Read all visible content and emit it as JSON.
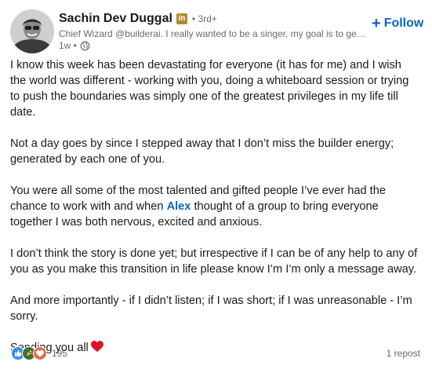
{
  "author": {
    "name": "Sachin Dev Duggal",
    "badge_icon": "linkedin-premium-icon",
    "badge_text": "in",
    "degree": "• 3rd+",
    "headline": "Chief Wizard @builderai. I really wanted to be a singer, my goal is to get the attention of the world and I need your help",
    "timestamp": "1w •",
    "visibility_icon": "globe-icon"
  },
  "follow": {
    "label": "Follow",
    "icon": "plus-icon"
  },
  "post": {
    "p1": "I know this week has been devastating for everyone (it has for me) and I wish the world was different - working with you, doing a whiteboard session or trying to push the boundaries was simply one of the greatest privileges in my life till date.",
    "p2": "Not a day goes by since I stepped away that I don’t miss the builder energy; generated by each one of you.",
    "p3_before": "You were all some of the most talented and gifted people I’ve ever had the chance to work with and when ",
    "p3_mention": "Alex",
    "p3_after": " thought of a group to bring everyone together I was both nervous, excited and anxious.",
    "p4": "I don’t think the story is done yet; but irrespective if I can be of any help to any of you as you make this transition in life please know I’m I’m only a message away.",
    "p5": "And more importantly - if I didn’t listen; if I was short; if I was unreasonable - I’m sorry.",
    "p6": "Sending you all",
    "p6_emoji": "red-heart-icon"
  },
  "social": {
    "reaction_icons": [
      "like-icon",
      "celebrate-icon",
      "love-icon"
    ],
    "reaction_count": "195",
    "reposts": "1 repost"
  },
  "colors": {
    "link_blue": "#0a66c2",
    "text": "#191919",
    "muted": "#666666",
    "like": "#378fe9",
    "celebrate": "#44712e",
    "love": "#df704d",
    "premium_gold": "#b58a2c"
  }
}
